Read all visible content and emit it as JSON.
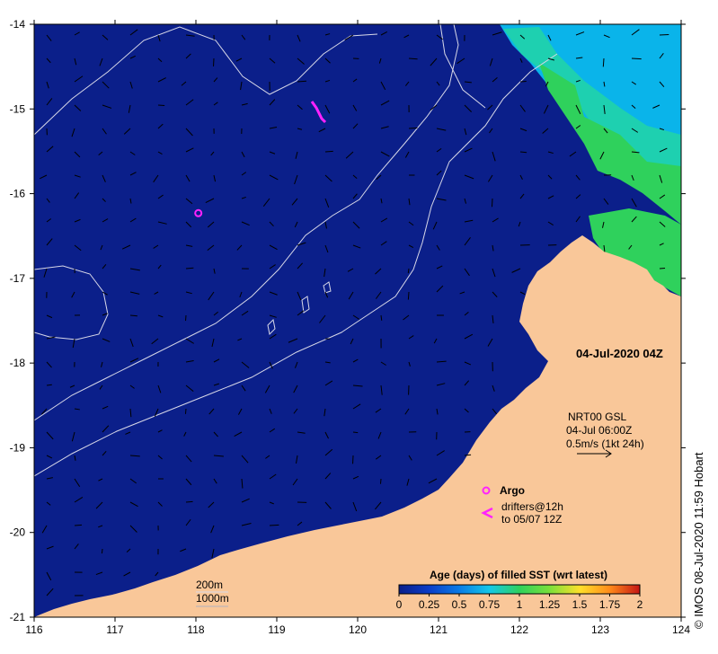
{
  "axes": {
    "x_ticks": [
      "116",
      "117",
      "118",
      "119",
      "120",
      "121",
      "122",
      "123",
      "124"
    ],
    "y_ticks": [
      "-14",
      "-15",
      "-16",
      "-17",
      "-18",
      "-19",
      "-20",
      "-21"
    ]
  },
  "map": {
    "lon_range": [
      116,
      124
    ],
    "lat_range": [
      -21,
      -14
    ],
    "timestamp": "04-Jul-2020 04Z",
    "land_color": "#f9c799",
    "ocean_color": "#0b1f8a"
  },
  "current_legend": {
    "line1": "NRT00 GSL",
    "line2": "04-Jul 06:00Z",
    "line3": "0.5m/s (1kt 24h)"
  },
  "argo_legend": {
    "label": "Argo",
    "drifters_line1": "drifters@12h",
    "drifters_line2": "to 05/07 12Z"
  },
  "isobaths": {
    "label1": "200m",
    "label2": "1000m"
  },
  "colorbar": {
    "title": "Age (days) of filled SST (wrt latest)",
    "ticks": [
      "0",
      "0.25",
      "0.5",
      "0.75",
      "1",
      "1.25",
      "1.5",
      "1.75",
      "2"
    ],
    "colors": [
      "#0b1f8a",
      "#0b3dc8",
      "#0a7ce6",
      "#14c8e8",
      "#2fd15c",
      "#7be03a",
      "#ffe02a",
      "#ff8a1a",
      "#c41414"
    ]
  },
  "argo_floats": [
    {
      "lon": 118.03,
      "lat": -16.23
    }
  ],
  "credit": "IMOS 08-Jul-2020 11:59 Hobart",
  "copyright_symbol": "©"
}
